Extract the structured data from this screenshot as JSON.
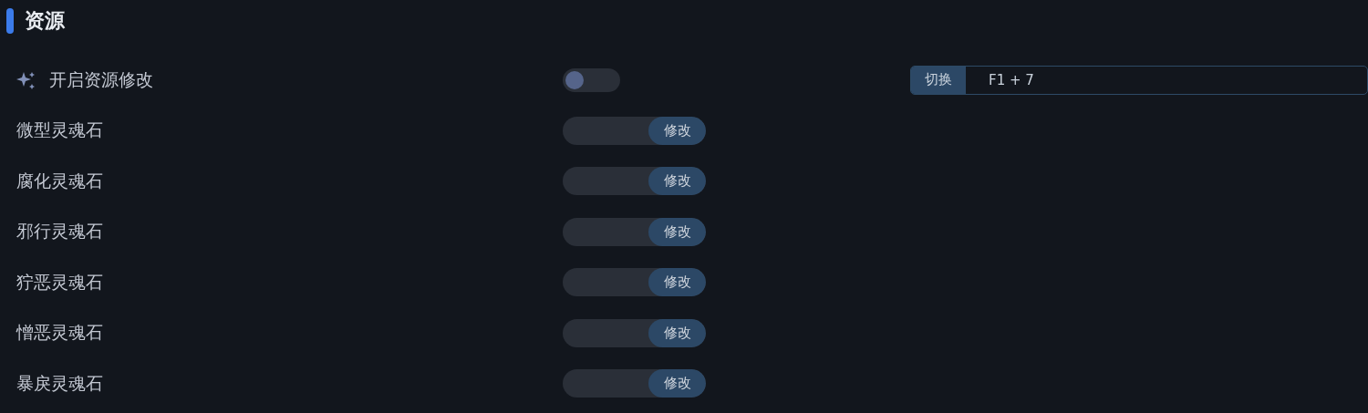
{
  "section": {
    "title": "资源"
  },
  "toggle": {
    "label": "开启资源修改",
    "on": false,
    "hotkey": {
      "action": "切换",
      "keys": "F1 + 7"
    }
  },
  "items": [
    {
      "label": "微型灵魂石",
      "button": "修改"
    },
    {
      "label": "腐化灵魂石",
      "button": "修改"
    },
    {
      "label": "邪行灵魂石",
      "button": "修改"
    },
    {
      "label": "狞恶灵魂石",
      "button": "修改"
    },
    {
      "label": "憎恶灵魂石",
      "button": "修改"
    },
    {
      "label": "暴戾灵魂石",
      "button": "修改"
    }
  ]
}
